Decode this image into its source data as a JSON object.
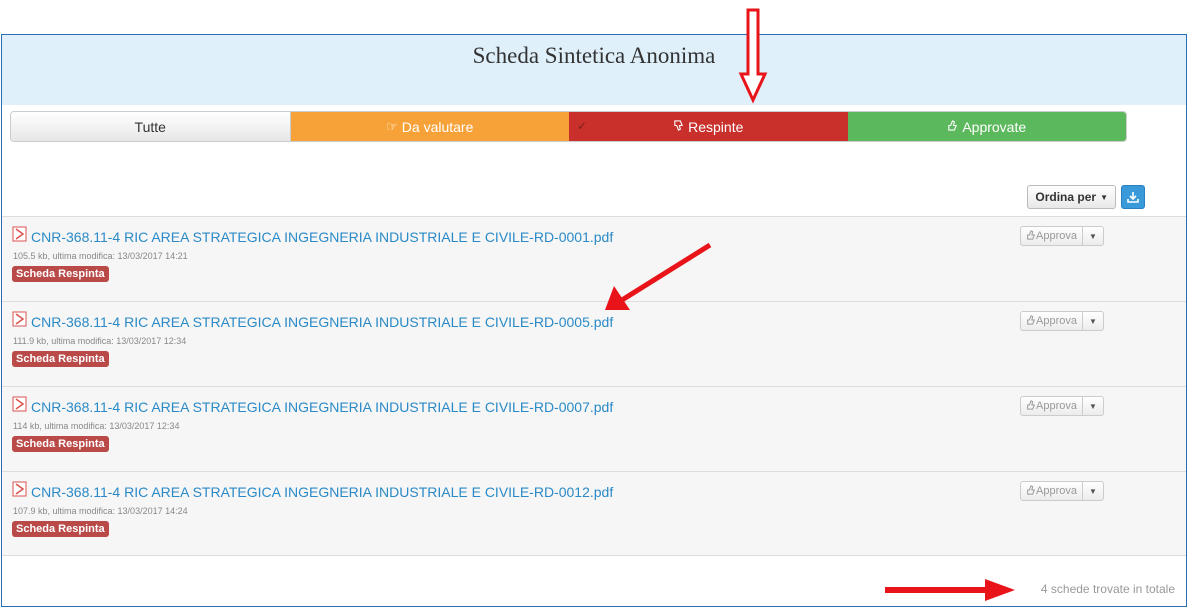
{
  "header": {
    "title": "Scheda Sintetica Anonima"
  },
  "filters": {
    "all": "Tutte",
    "pending": "Da valutare",
    "rejected": "Respinte",
    "approved": "Approvate",
    "check": "✓"
  },
  "toolbar": {
    "sort_label": "Ordina per"
  },
  "files": [
    {
      "name": "CNR-368.11-4 RIC AREA STRATEGICA INGEGNERIA INDUSTRIALE E CIVILE-RD-0001.pdf",
      "meta": "105.5 kb, ultima modifica: 13/03/2017 14:21",
      "badge": "Scheda Respinta",
      "action": "Approva"
    },
    {
      "name": "CNR-368.11-4 RIC AREA STRATEGICA INGEGNERIA INDUSTRIALE E CIVILE-RD-0005.pdf",
      "meta": "111.9 kb, ultima modifica: 13/03/2017 12:34",
      "badge": "Scheda Respinta",
      "action": "Approva"
    },
    {
      "name": "CNR-368.11-4 RIC AREA STRATEGICA INGEGNERIA INDUSTRIALE E CIVILE-RD-0007.pdf",
      "meta": "114 kb, ultima modifica: 13/03/2017 12:34",
      "badge": "Scheda Respinta",
      "action": "Approva"
    },
    {
      "name": "CNR-368.11-4 RIC AREA STRATEGICA INGEGNERIA INDUSTRIALE E CIVILE-RD-0012.pdf",
      "meta": "107.9 kb, ultima modifica: 13/03/2017 14:24",
      "badge": "Scheda Respinta",
      "action": "Approva"
    }
  ],
  "footer": {
    "count": "4 schede trovate in totale"
  },
  "colors": {
    "header_bg": "#dff0fb",
    "pending": "#f7a238",
    "rejected": "#c9302c",
    "approved": "#5cb85c",
    "link": "#2a8ac7",
    "badge": "#b94a48",
    "annotation_arrow": "#e8141a"
  },
  "icons": {
    "pending": "thumbs-up-pointing-right-icon",
    "rejected": "thumbs-down-icon",
    "approved": "thumbs-up-icon",
    "file": "pdf-icon",
    "download": "download-icon"
  }
}
